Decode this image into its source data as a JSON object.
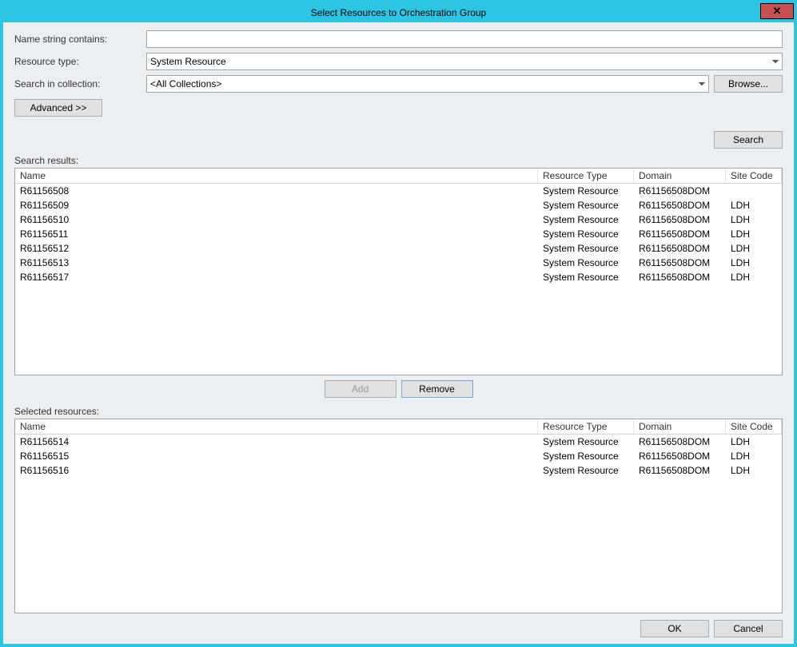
{
  "window": {
    "title": "Select Resources to Orchestration Group"
  },
  "form": {
    "nameLabel": "Name string contains:",
    "nameValue": "",
    "resourceTypeLabel": "Resource type:",
    "resourceTypeValue": "System Resource",
    "collectionLabel": "Search in collection:",
    "collectionValue": "<All Collections>",
    "browseLabel": "Browse...",
    "advancedLabel": "Advanced >>",
    "searchLabel": "Search"
  },
  "results": {
    "label": "Search results:",
    "columns": {
      "name": "Name",
      "type": "Resource Type",
      "domain": "Domain",
      "site": "Site Code"
    },
    "rows": [
      {
        "name": "R61156508",
        "type": "System Resource",
        "domain": "R61156508DOM",
        "site": ""
      },
      {
        "name": "R61156509",
        "type": "System Resource",
        "domain": "R61156508DOM",
        "site": "LDH"
      },
      {
        "name": "R61156510",
        "type": "System Resource",
        "domain": "R61156508DOM",
        "site": "LDH"
      },
      {
        "name": "R61156511",
        "type": "System Resource",
        "domain": "R61156508DOM",
        "site": "LDH"
      },
      {
        "name": "R61156512",
        "type": "System Resource",
        "domain": "R61156508DOM",
        "site": "LDH"
      },
      {
        "name": "R61156513",
        "type": "System Resource",
        "domain": "R61156508DOM",
        "site": "LDH"
      },
      {
        "name": "R61156517",
        "type": "System Resource",
        "domain": "R61156508DOM",
        "site": "LDH"
      }
    ]
  },
  "middle": {
    "addLabel": "Add",
    "removeLabel": "Remove"
  },
  "selected": {
    "label": "Selected resources:",
    "columns": {
      "name": "Name",
      "type": "Resource Type",
      "domain": "Domain",
      "site": "Site Code"
    },
    "rows": [
      {
        "name": "R61156514",
        "type": "System Resource",
        "domain": "R61156508DOM",
        "site": "LDH"
      },
      {
        "name": "R61156515",
        "type": "System Resource",
        "domain": "R61156508DOM",
        "site": "LDH"
      },
      {
        "name": "R61156516",
        "type": "System Resource",
        "domain": "R61156508DOM",
        "site": "LDH"
      }
    ]
  },
  "footer": {
    "okLabel": "OK",
    "cancelLabel": "Cancel"
  }
}
